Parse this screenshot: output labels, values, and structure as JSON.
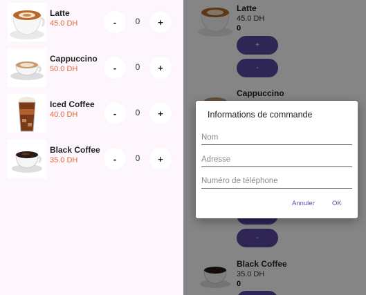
{
  "left_list": {
    "items": [
      {
        "name": "Latte",
        "price": "45.0 DH",
        "minus": "-",
        "qty": "0",
        "plus": "+"
      },
      {
        "name": "Cappuccino",
        "price": "50.0 DH",
        "minus": "-",
        "qty": "0",
        "plus": "+"
      },
      {
        "name": "Iced Coffee",
        "price": "40.0 DH",
        "minus": "-",
        "qty": "0",
        "plus": "+"
      },
      {
        "name": "Black Coffee",
        "price": "35.0 DH",
        "minus": "-",
        "qty": "0",
        "plus": "+"
      }
    ]
  },
  "right_list": {
    "items": [
      {
        "name": "Latte",
        "price": "45.0 DH",
        "qty": "0",
        "plus_label": "+",
        "minus_label": "-"
      },
      {
        "name": "Cappuccino",
        "minus_label": "-"
      },
      {
        "name": "Black Coffee",
        "price": "35.0 DH",
        "qty": "0"
      }
    ]
  },
  "dialog": {
    "title": "Informations de commande",
    "fields": [
      {
        "placeholder": "Nom"
      },
      {
        "placeholder": "Adresse"
      },
      {
        "placeholder": "Numéro de téléphone"
      }
    ],
    "cancel_label": "Annuler",
    "ok_label": "OK"
  },
  "colors": {
    "left_bg": "#fdf6fc",
    "price_orange": "#e06a3a",
    "accent_purple": "#5b4aa5"
  }
}
